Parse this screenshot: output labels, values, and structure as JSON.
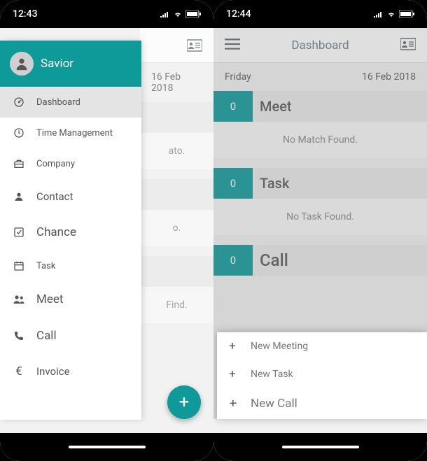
{
  "status": {
    "time_left": "12:43",
    "time_right": "12:44"
  },
  "header": {
    "title": "Dashboard"
  },
  "date": {
    "day": "Friday",
    "full": "16 Feb 2018"
  },
  "sidebar": {
    "username": "Savior",
    "items": [
      {
        "label": "Dashboard",
        "icon": "gauge",
        "active": true
      },
      {
        "label": "Time Management",
        "icon": "clock"
      },
      {
        "label": "Company",
        "icon": "briefcase"
      },
      {
        "label": "Contact",
        "icon": "person"
      },
      {
        "label": "Chance",
        "icon": "check-square"
      },
      {
        "label": "Task",
        "icon": "calendar"
      },
      {
        "label": "Meet",
        "icon": "people"
      },
      {
        "label": "Call",
        "icon": "phone"
      },
      {
        "label": "Invoice",
        "icon": "euro"
      }
    ]
  },
  "sections": [
    {
      "title": "Meet",
      "count": "0",
      "empty": "No Match Found."
    },
    {
      "title": "Task",
      "count": "0",
      "empty": "No Task Found."
    },
    {
      "title": "Call",
      "count": "0",
      "empty": ""
    }
  ],
  "left_peek": {
    "date": "16 Feb 2018",
    "body1": "ato.",
    "body2": "o.",
    "body3": "Find."
  },
  "fab_menu": [
    {
      "label": "New Meeting"
    },
    {
      "label": "New Task"
    },
    {
      "label": "New Call"
    }
  ],
  "colors": {
    "accent": "#0f9a9a"
  }
}
